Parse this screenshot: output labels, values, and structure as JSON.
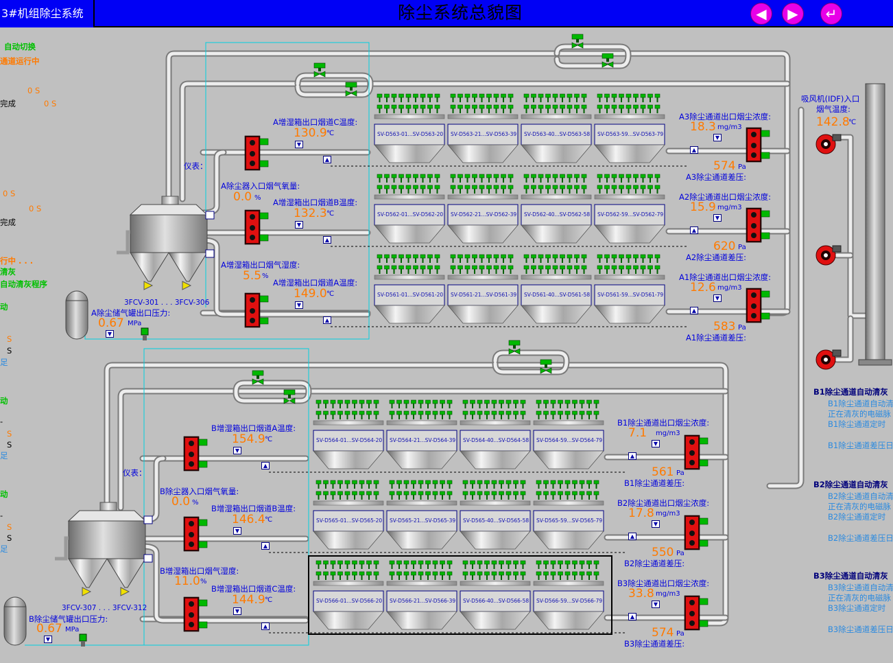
{
  "header": {
    "tab_title": "3#机组除尘系统",
    "title": "除尘系统总貌图",
    "nav_prev_glyph": "◀",
    "nav_next_glyph": "▶",
    "nav_return_glyph": "↵"
  },
  "left_panel": {
    "auto_switch": "自动切换",
    "channel_running": "通道运行中",
    "s1": "0 S",
    "done1_s": "0 S",
    "done1": "完成",
    "s2": "0 S",
    "s3": "0 S",
    "done2": "完成",
    "running2": "行中 . . .",
    "cleaning": "清灰",
    "auto_program": "自动清灰程序",
    "auto_a": "动",
    "a_s1": "S",
    "a_s2": "S",
    "a_zu": "足",
    "auto_b": "动",
    "b_s1": "S",
    "b_s2": "S",
    "b_zu": "足",
    "auto_c": "动",
    "c_s1": "S",
    "c_s2": "S",
    "c_zu": "足",
    "dash": "-"
  },
  "unit_a": {
    "instrument_label": "仪表：",
    "o2_label": "A除尘器入口烟气氧量:",
    "o2_value": "0.0",
    "o2_unit": "%",
    "humid_label": "A增湿箱出口烟气湿度:",
    "humid_value": "5.5",
    "humid_unit": "%",
    "tank_label": "A除尘储气罐出口压力:",
    "tank_value": "0.67",
    "tank_unit": "MPa",
    "valve_label": "3FCV-301 . . . 3FCV-306",
    "ducts": [
      {
        "temp_label": "A增湿箱出口烟道C温度:",
        "temp_value": "130.9",
        "temp_unit": "℃",
        "out_label": "A3除尘通道出口烟尘浓度:",
        "dust_value": "18.3",
        "dust_unit": "mg/m3",
        "dp_value": "574",
        "dp_unit": "Pa",
        "dp_label": "A3除尘通道差压:",
        "modules": [
          "SV-D563-01...SV-D563-20",
          "SV-D563-21...SV-D563-39",
          "SV-D563-40...SV-D563-58",
          "SV-D563-59...SV-D563-79"
        ]
      },
      {
        "temp_label": "A增湿箱出口烟道B温度:",
        "temp_value": "132.3",
        "temp_unit": "℃",
        "out_label": "A2除尘通道出口烟尘浓度:",
        "dust_value": "15.9",
        "dust_unit": "mg/m3",
        "dp_value": "620",
        "dp_unit": "Pa",
        "dp_label": "A2除尘通道差压:",
        "modules": [
          "SV-D562-01...SV-D562-20",
          "SV-D562-21...SV-D562-39",
          "SV-D562-40...SV-D562-58",
          "SV-D562-59...SV-D562-79"
        ]
      },
      {
        "temp_label": "A增湿箱出口烟道A温度:",
        "temp_value": "149.0",
        "temp_unit": "℃",
        "out_label": "A1除尘通道出口烟尘浓度:",
        "dust_value": "12.6",
        "dust_unit": "mg/m3",
        "dp_value": "583",
        "dp_unit": "Pa",
        "dp_label": "A1除尘通道差压:",
        "modules": [
          "SV-D561-01...SV-D561-20",
          "SV-D561-21...SV-D561-39",
          "SV-D561-40...SV-D561-58",
          "SV-D561-59...SV-D561-79"
        ]
      }
    ]
  },
  "unit_b": {
    "instrument_label": "仪表：",
    "o2_label": "B除尘器入口烟气氧量:",
    "o2_value": "0.0",
    "o2_unit": "%",
    "humid_label": "B增湿箱出口烟气湿度:",
    "humid_value": "11.0",
    "humid_unit": "%",
    "tank_label": "B除尘储气罐出口压力:",
    "tank_value": "0.67",
    "tank_unit": "MPa",
    "valve_label": "3FCV-307 . . . 3FCV-312",
    "ducts": [
      {
        "temp_label": "B增湿箱出口烟道A温度:",
        "temp_value": "154.9",
        "temp_unit": "℃",
        "out_label": "B1除尘通道出口烟尘浓度:",
        "dust_value": "7.1",
        "dust_unit": "mg/m3",
        "dp_value": "561",
        "dp_unit": "Pa",
        "dp_label": "B1除尘通道差压:",
        "modules": [
          "SV-D564-01...SV-D564-20",
          "SV-D564-21...SV-D564-39",
          "SV-D564-40...SV-D564-58",
          "SV-D564-59...SV-D564-79"
        ]
      },
      {
        "temp_label": "B增湿箱出口烟道B温度:",
        "temp_value": "146.4",
        "temp_unit": "℃",
        "out_label": "B2除尘通道出口烟尘浓度:",
        "dust_value": "17.8",
        "dust_unit": "mg/m3",
        "dp_value": "550",
        "dp_unit": "Pa",
        "dp_label": "B2除尘通道差压:",
        "modules": [
          "SV-D565-01...SV-D565-20",
          "SV-D565-21...SV-D565-39",
          "SV-D565-40...SV-D565-58",
          "SV-D565-59...SV-D565-79"
        ]
      },
      {
        "temp_label": "B增湿箱出口烟道C温度:",
        "temp_value": "144.9",
        "temp_unit": "℃",
        "out_label": "B3除尘通道出口烟尘浓度:",
        "dust_value": "33.8",
        "dust_unit": "mg/m3",
        "dp_value": "574",
        "dp_unit": "Pa",
        "dp_label": "B3除尘通道差压:",
        "modules": [
          "SV-D566-01...SV-D566-20",
          "SV-D566-21...SV-D566-39",
          "SV-D566-40...SV-D566-58",
          "SV-D566-59...SV-D566-79"
        ]
      }
    ]
  },
  "idf": {
    "label_line1": "吸风机(IDF)入口",
    "label_line2": "烟气温度:",
    "temp_value": "142.8",
    "temp_unit": "℃"
  },
  "right_panel": [
    {
      "title": "B1除尘通道自动清灰",
      "line1": "B1除尘通道自动清",
      "line2": "正在清灰的电磁脉",
      "line3": "B1除尘通道定时",
      "line4": "B1除尘通道差压日"
    },
    {
      "title": "B2除尘通道自动清灰",
      "line1": "B2除尘通道自动清",
      "line2": "正在清灰的电磁脉",
      "line3": "B2除尘通道定时",
      "line4": "B2除尘通道差压日"
    },
    {
      "title": "B3除尘通道自动清灰",
      "line1": "B3除尘通道自动清",
      "line2": "正在清灰的电磁脉",
      "line3": "B3除尘通道定时",
      "line4": "B3除尘通道差压日"
    }
  ],
  "colors": {
    "header_bg": "#0000f5",
    "background": "#c0c0c0",
    "value_orange": "#ff7a00",
    "label_blue": "#0000dd",
    "status_green": "#00c000",
    "valve_red": "#e01010",
    "solenoid_green": "#00b800",
    "nav_magenta": "#e800e8"
  },
  "icons": {
    "nav_prev": "triangle-left-icon",
    "nav_next": "triangle-right-icon",
    "nav_return": "return-arrow-icon",
    "valve": "red-damper-valve-icon",
    "solenoid": "green-solenoid-valve-icon",
    "fan": "red-fan-icon",
    "tank": "gas-tank-icon",
    "stack": "chimney-icon"
  }
}
